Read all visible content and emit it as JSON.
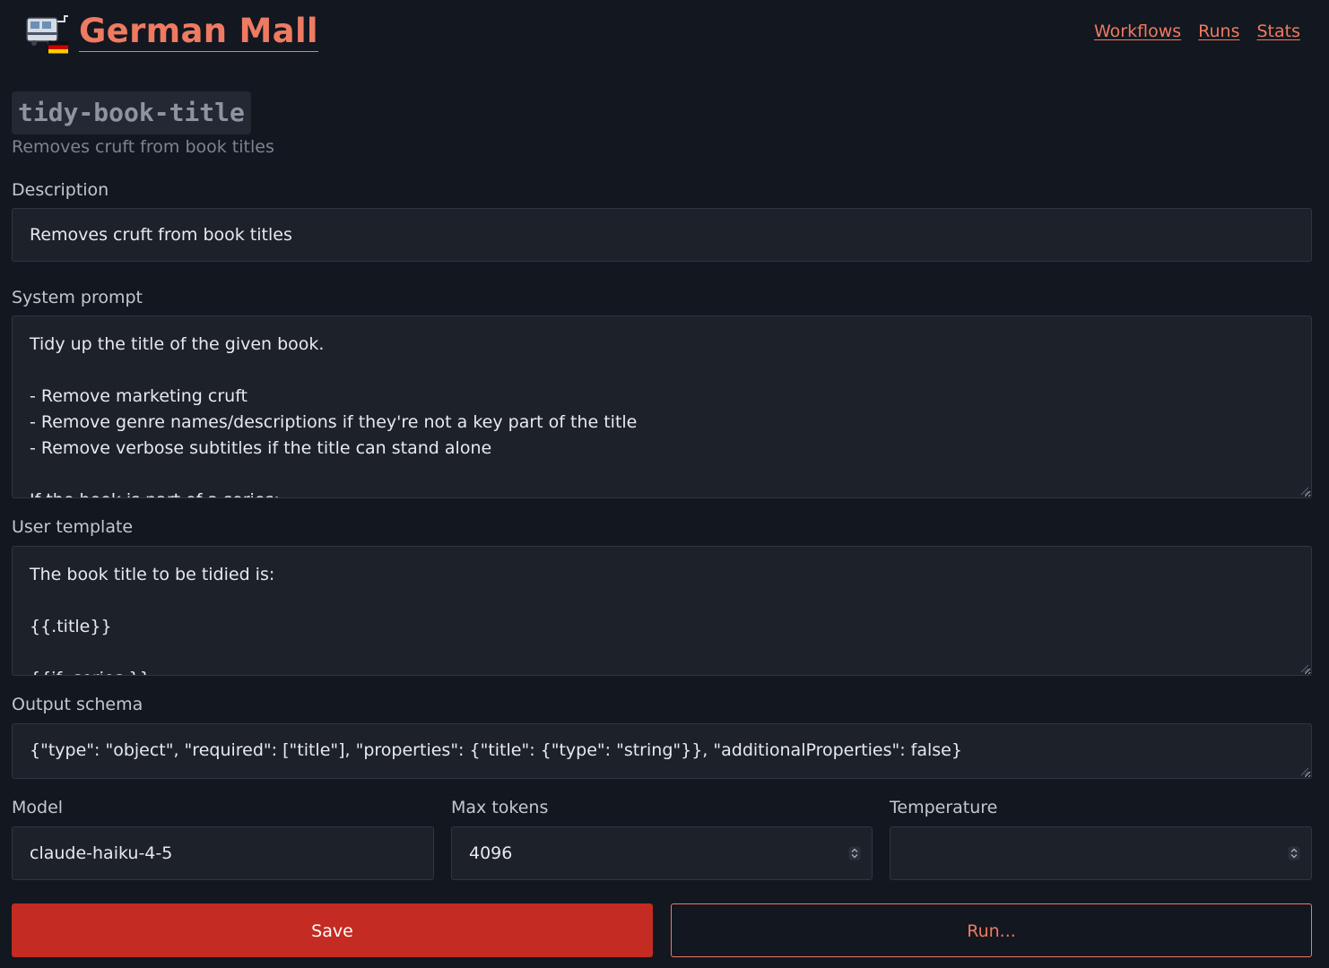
{
  "header": {
    "brand": "German Mall",
    "logo_icon": "train-with-german-flag-icon",
    "nav": [
      {
        "label": "Workflows"
      },
      {
        "label": "Runs"
      },
      {
        "label": "Stats"
      }
    ]
  },
  "workflow": {
    "name": "tidy-book-title",
    "subtitle": "Removes cruft from book titles"
  },
  "form": {
    "description": {
      "label": "Description",
      "value": "Removes cruft from book titles"
    },
    "system_prompt": {
      "label": "System prompt",
      "value": "Tidy up the title of the given book.\n\n- Remove marketing cruft\n- Remove genre names/descriptions if they're not a key part of the title\n- Remove verbose subtitles if the title can stand alone\n\nIf the book is part of a series:"
    },
    "user_template": {
      "label": "User template",
      "value": "The book title to be tidied is:\n\n{{.title}}\n\n{{if .series }}"
    },
    "output_schema": {
      "label": "Output schema",
      "value": "{\"type\": \"object\", \"required\": [\"title\"], \"properties\": {\"title\": {\"type\": \"string\"}}, \"additionalProperties\": false}"
    },
    "model": {
      "label": "Model",
      "value": "claude-haiku-4-5"
    },
    "max_tokens": {
      "label": "Max tokens",
      "value": "4096"
    },
    "temperature": {
      "label": "Temperature",
      "value": ""
    }
  },
  "actions": {
    "save_label": "Save",
    "run_label": "Run..."
  },
  "colors": {
    "background": "#13171f",
    "accent": "#ef7a62",
    "primary_button": "#c42b22",
    "field_bg": "#1d2129"
  }
}
